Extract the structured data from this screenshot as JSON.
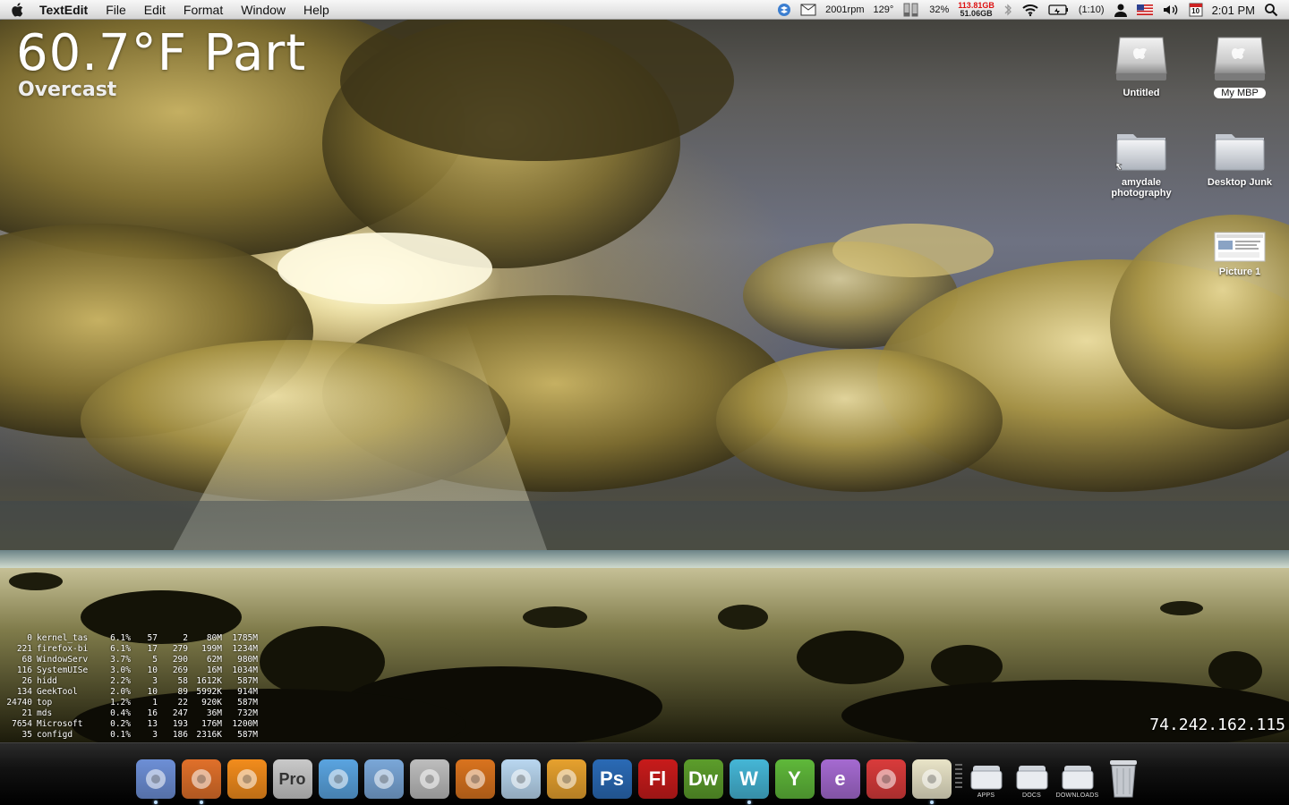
{
  "menubar": {
    "app_name": "TextEdit",
    "menus": [
      "File",
      "Edit",
      "Format",
      "Window",
      "Help"
    ],
    "status": {
      "fan_speed": "2001rpm",
      "temperature": "129°",
      "battery_percent": "32%",
      "disk_used": "113.81GB",
      "disk_free": "51.06GB",
      "battery_time": "(1:10)",
      "calendar_day": "10",
      "clock": "2:01 PM"
    }
  },
  "weather": {
    "temperature_line": "60.7°F Part",
    "condition": "Overcast"
  },
  "desktop_icons": [
    {
      "label": "Untitled",
      "type": "drive"
    },
    {
      "label": "My MBP",
      "type": "drive",
      "selected": true
    },
    {
      "label": "amydale photography",
      "type": "folder-alias"
    },
    {
      "label": "Desktop Junk",
      "type": "folder"
    },
    {
      "label": "Picture 1",
      "type": "screenshot"
    }
  ],
  "processes": [
    {
      "pid": "0",
      "name": "kernel_tas",
      "cpu": "6.1%",
      "threads": "57",
      "ports": "2",
      "rsize": "80M",
      "vsize": "1785M"
    },
    {
      "pid": "221",
      "name": "firefox-bi",
      "cpu": "6.1%",
      "threads": "17",
      "ports": "279",
      "rsize": "199M",
      "vsize": "1234M"
    },
    {
      "pid": "68",
      "name": "WindowServ",
      "cpu": "3.7%",
      "threads": "5",
      "ports": "290",
      "rsize": "62M",
      "vsize": "980M"
    },
    {
      "pid": "116",
      "name": "SystemUISe",
      "cpu": "3.0%",
      "threads": "10",
      "ports": "269",
      "rsize": "16M",
      "vsize": "1034M"
    },
    {
      "pid": "26",
      "name": "hidd",
      "cpu": "2.2%",
      "threads": "3",
      "ports": "58",
      "rsize": "1612K",
      "vsize": "587M"
    },
    {
      "pid": "134",
      "name": "GeekTool",
      "cpu": "2.0%",
      "threads": "10",
      "ports": "89",
      "rsize": "5992K",
      "vsize": "914M"
    },
    {
      "pid": "24740",
      "name": "top",
      "cpu": "1.2%",
      "threads": "1",
      "ports": "22",
      "rsize": "920K",
      "vsize": "587M"
    },
    {
      "pid": "21",
      "name": "mds",
      "cpu": "0.4%",
      "threads": "16",
      "ports": "247",
      "rsize": "36M",
      "vsize": "732M"
    },
    {
      "pid": "7654",
      "name": "Microsoft",
      "cpu": "0.2%",
      "threads": "13",
      "ports": "193",
      "rsize": "176M",
      "vsize": "1200M"
    },
    {
      "pid": "35",
      "name": "configd",
      "cpu": "0.1%",
      "threads": "3",
      "ports": "186",
      "rsize": "2316K",
      "vsize": "587M"
    }
  ],
  "ip_address": "74.242.162.115",
  "dock": {
    "apps": [
      {
        "icon": "finder-icon",
        "text": "",
        "color": "#6d8fd6",
        "running": true
      },
      {
        "icon": "firefox-icon",
        "text": "",
        "color": "#e0702a",
        "running": true
      },
      {
        "icon": "vlc-icon",
        "text": "",
        "color": "#f28c1c",
        "running": false
      },
      {
        "icon": "pro-icon",
        "text": "Pro",
        "color": "#c9c9c9",
        "running": false
      },
      {
        "icon": "itunes-icon",
        "text": "",
        "color": "#5aa4e0",
        "running": false
      },
      {
        "icon": "preview-icon",
        "text": "",
        "color": "#7aa7d8",
        "running": false
      },
      {
        "icon": "shield-icon",
        "text": "",
        "color": "#bdbdbd",
        "running": false
      },
      {
        "icon": "propellerhead-icon",
        "text": "",
        "color": "#d9731e",
        "running": false
      },
      {
        "icon": "mail-clock-icon",
        "text": "",
        "color": "#b9d7f0",
        "running": false
      },
      {
        "icon": "runner-icon",
        "text": "",
        "color": "#e6a12e",
        "running": false
      },
      {
        "icon": "photoshop-icon",
        "text": "Ps",
        "color": "#2a6ab5",
        "running": false
      },
      {
        "icon": "flash-icon",
        "text": "Fl",
        "color": "#c81b1b",
        "running": false
      },
      {
        "icon": "dreamweaver-icon",
        "text": "Dw",
        "color": "#5c9d2b",
        "running": false
      },
      {
        "icon": "w-icon",
        "text": "W",
        "color": "#45b6d6",
        "running": true
      },
      {
        "icon": "y-icon",
        "text": "Y",
        "color": "#5fb83a",
        "running": false
      },
      {
        "icon": "e-icon",
        "text": "e",
        "color": "#a56ad1",
        "running": false
      },
      {
        "icon": "chess-icon",
        "text": "",
        "color": "#d93b3b",
        "running": false
      },
      {
        "icon": "textedit-icon",
        "text": "",
        "color": "#e9e4c8",
        "running": true
      }
    ],
    "stacks": [
      {
        "icon": "apps-stack-icon",
        "label": "APPS"
      },
      {
        "icon": "docs-stack-icon",
        "label": "DOCS"
      },
      {
        "icon": "downloads-stack-icon",
        "label": "DOWNLOADS"
      }
    ],
    "trash_icon": "trash-icon"
  }
}
